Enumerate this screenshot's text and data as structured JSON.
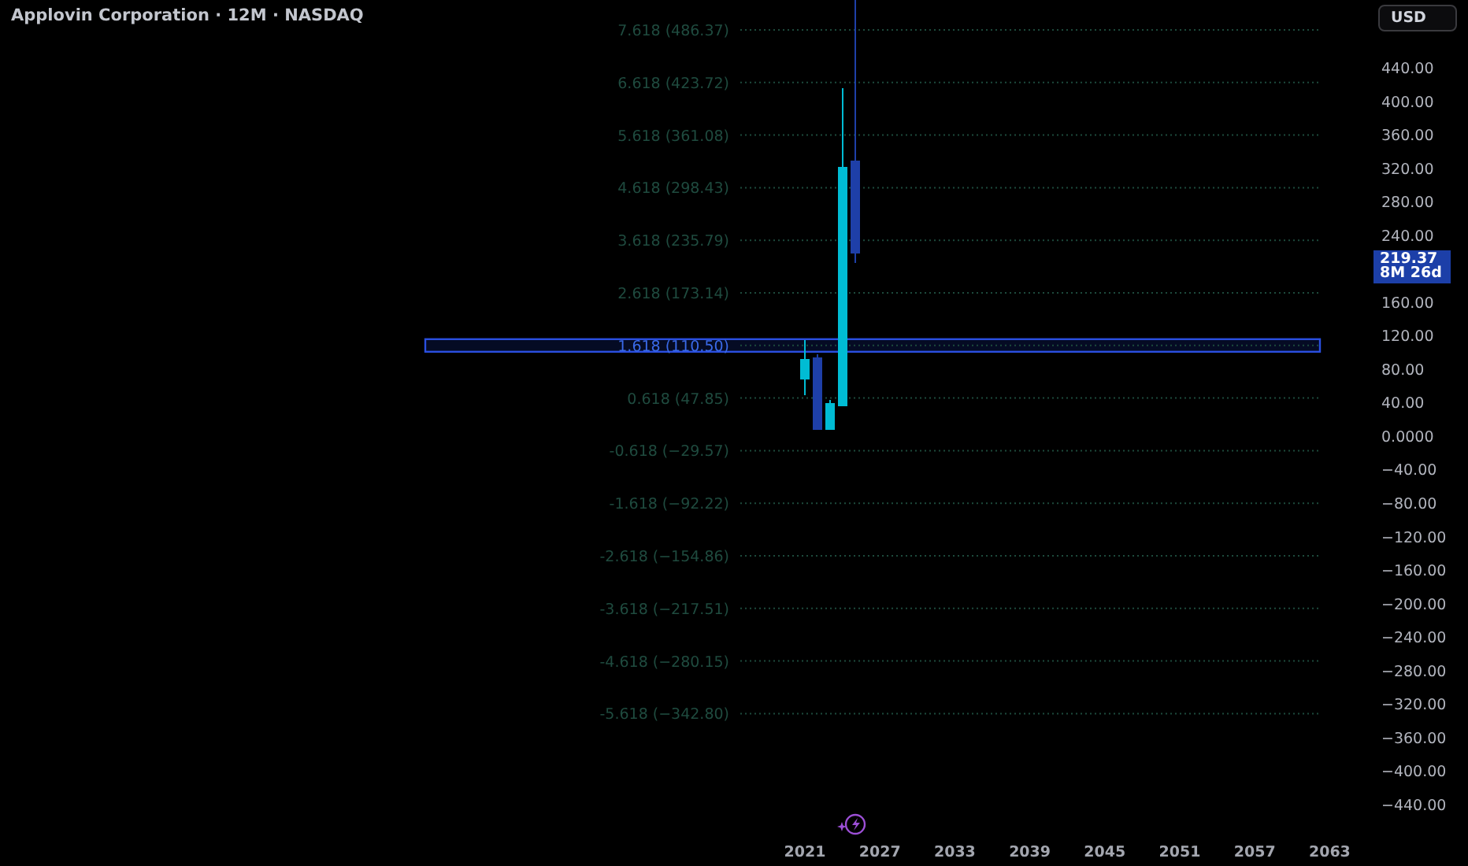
{
  "header": {
    "title": "Applovin Corporation · 12M · NASDAQ"
  },
  "currency_button": {
    "label": "USD"
  },
  "fib_levels": [
    {
      "label": "7.618 (486.37)"
    },
    {
      "label": "6.618 (423.72)"
    },
    {
      "label": "5.618 (361.08)"
    },
    {
      "label": "4.618 (298.43)"
    },
    {
      "label": "3.618 (235.79)"
    },
    {
      "label": "2.618 (173.14)"
    },
    {
      "label": "1.618 (110.50)",
      "highlighted": true
    },
    {
      "label": "0.618 (47.85)"
    },
    {
      "label": "-0.618 (−29.57)"
    },
    {
      "label": "-1.618 (−92.22)"
    },
    {
      "label": "-2.618 (−154.86)"
    },
    {
      "label": "-3.618 (−217.51)"
    },
    {
      "label": "-4.618 (−280.15)"
    },
    {
      "label": "-5.618 (−342.80)"
    }
  ],
  "price_axis": {
    "labels_above": [
      "440.00",
      "400.00",
      "360.00",
      "320.00",
      "280.00",
      "240.00"
    ],
    "price_tag": {
      "price": "219.37",
      "countdown": "8M 26d"
    },
    "labels_below": [
      "160.00",
      "120.00",
      "80.00",
      "40.00",
      "0.0000",
      "−40.00",
      "−80.00",
      "−120.00",
      "−160.00",
      "−200.00",
      "−240.00",
      "−280.00",
      "−320.00",
      "−360.00",
      "−400.00",
      "−440.00"
    ]
  },
  "time_axis": {
    "labels": [
      "2021",
      "2027",
      "2033",
      "2039",
      "2045",
      "2051",
      "2057",
      "2063"
    ]
  }
}
